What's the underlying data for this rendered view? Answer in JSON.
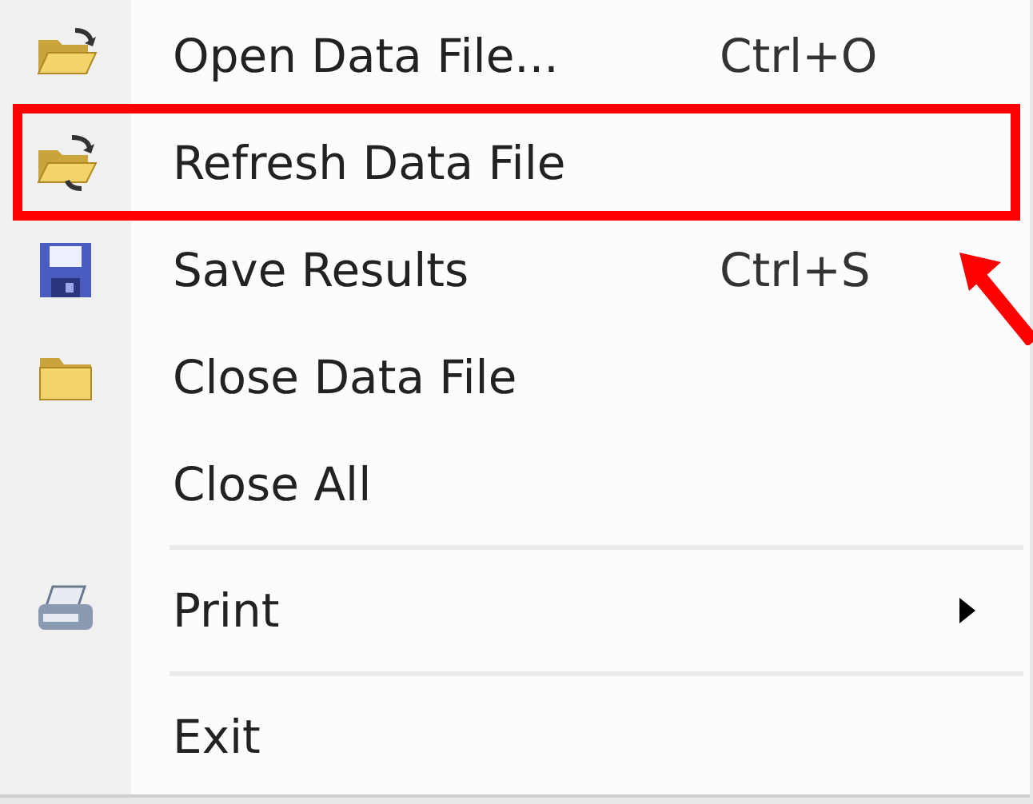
{
  "menu": {
    "items": [
      {
        "kind": "item",
        "label": "Open Data File...",
        "shortcut": "Ctrl+O",
        "highlighted": false,
        "submenu": false
      },
      {
        "kind": "item",
        "label": "Refresh Data File",
        "highlighted": true,
        "submenu": false
      },
      {
        "kind": "item",
        "label": "Save Results",
        "shortcut": "Ctrl+S",
        "highlighted": false,
        "submenu": false
      },
      {
        "kind": "item",
        "label": "Close Data File",
        "highlighted": false,
        "submenu": false
      },
      {
        "kind": "item",
        "label": "Close All",
        "highlighted": false,
        "submenu": false
      },
      {
        "kind": "separator"
      },
      {
        "kind": "item",
        "label": "Print",
        "highlighted": false,
        "submenu": true
      },
      {
        "kind": "separator"
      },
      {
        "kind": "item",
        "label": "Exit",
        "highlighted": false,
        "submenu": false
      }
    ]
  },
  "annotation": {
    "arrow": true
  }
}
